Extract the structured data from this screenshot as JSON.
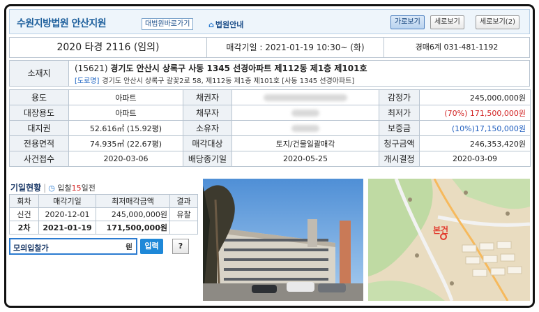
{
  "header": {
    "court_name": "수원지방법원 안산지원",
    "court_link_label": "대법원바로가기",
    "court_guide_label": "법원안내",
    "view_buttons": [
      "가로보기",
      "세로보기",
      "세로보기(2)"
    ]
  },
  "case": {
    "case_number": "2020 타경 2116 (임의)",
    "sale_date": "매각기일 : 2021-01-19 10:30~ (화)",
    "department": "경매6계 031-481-1192"
  },
  "address": {
    "label": "소재지",
    "zip": "(15621)",
    "main": "경기도 안산시 상록구 사동 1345 선경아파트 제112동 제1층 제101호",
    "road_tag": "[도로명]",
    "road": "경기도 안산시 상록구 갈꽃2로 58, 제112동 제1층 제101호 [사동 1345 선경아파트]"
  },
  "info": {
    "usage_label": "용도",
    "usage": "아파트",
    "creditor_label": "채권자",
    "appraisal_label": "감정가",
    "appraisal": "245,000,000원",
    "ledger_usage_label": "대장용도",
    "ledger_usage": "아파트",
    "debtor_label": "채무자",
    "min_price_label": "최저가",
    "min_price": "(70%) 171,500,000원",
    "land_right_label": "대지권",
    "land_right": "52.616㎡ (15.92평)",
    "owner_label": "소유자",
    "deposit_label": "보증금",
    "deposit": "(10%)17,150,000원",
    "area_label": "전용면적",
    "area": "74.935㎡ (22.67평)",
    "sale_target_label": "매각대상",
    "sale_target": "토지/건물일괄매각",
    "claim_label": "청구금액",
    "claim": "246,353,420원",
    "receipt_label": "사건접수",
    "receipt": "2020-03-06",
    "dividend_label": "배당종기일",
    "dividend": "2020-05-25",
    "start_label": "개시결정",
    "start": "2020-03-09"
  },
  "history": {
    "title": "기일현황",
    "sub_prefix": "입찰",
    "days_left": "15",
    "sub_suffix": "일전",
    "headers": [
      "회차",
      "매각기일",
      "최저매각금액",
      "결과"
    ],
    "rows": [
      {
        "round": "신건",
        "date": "2020-12-01",
        "price": "245,000,000원",
        "result": "유찰"
      },
      {
        "round": "2차",
        "date": "2021-01-19",
        "price": "171,500,000원",
        "result": ""
      }
    ]
  },
  "mock_bid": {
    "label": "모의입찰가",
    "value": "0",
    "unit": "원",
    "submit_label": "입력",
    "help_label": "?"
  },
  "map": {
    "marker_label": "본건"
  },
  "colors": {
    "accent_blue": "#1d5f9c",
    "price_red": "#d22222",
    "deposit_blue": "#1f5ebf"
  }
}
